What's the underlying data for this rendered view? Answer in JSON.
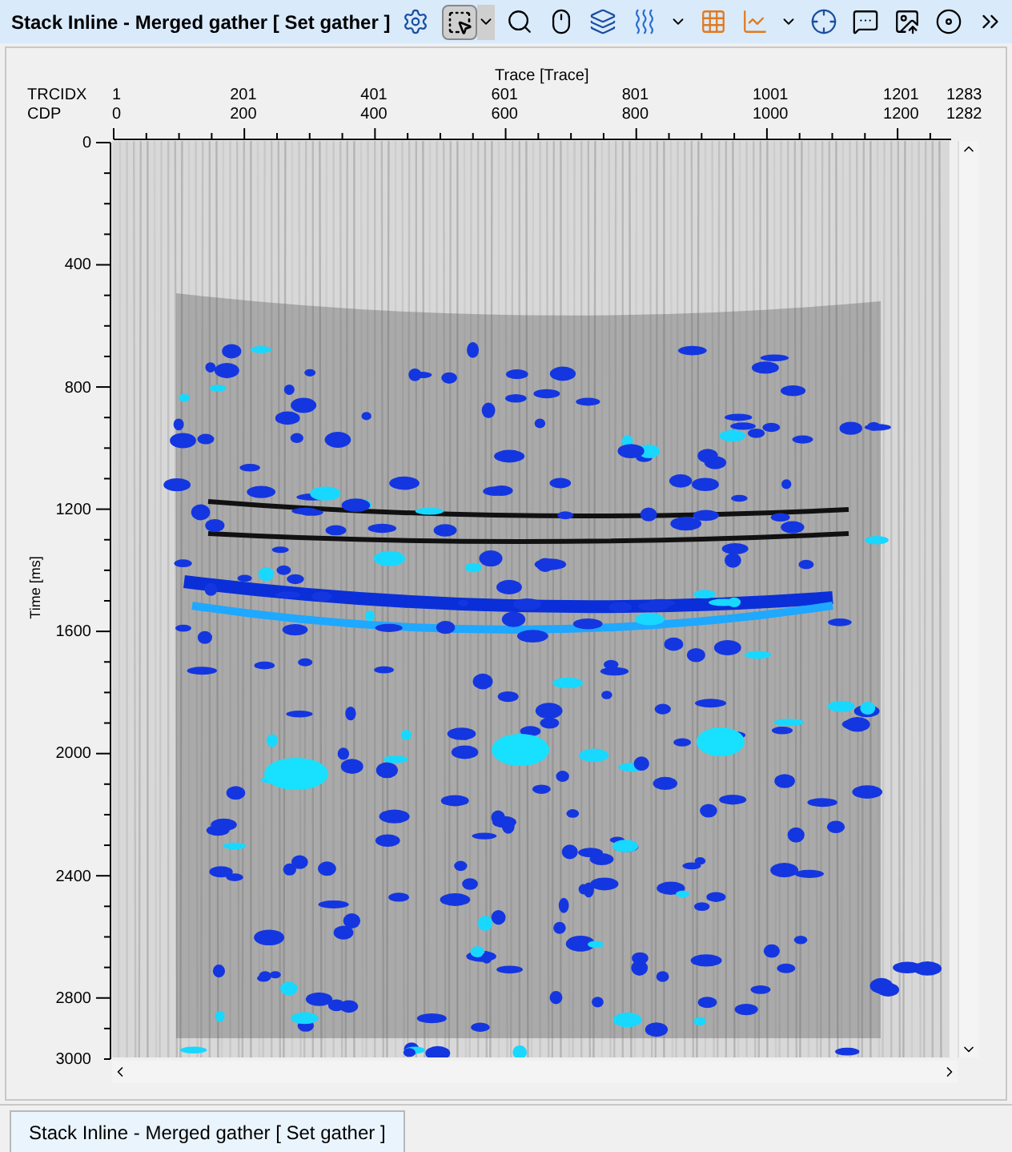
{
  "window": {
    "title": "Stack Inline - Merged gather [ Set gather ]"
  },
  "toolbar": {
    "select_tool_active": true
  },
  "x_axis": {
    "title": "Trace [Trace]",
    "rows": [
      {
        "label": "TRCIDX",
        "ticks": [
          "1",
          "201",
          "401",
          "601",
          "801",
          "1001",
          "1201",
          "1283"
        ]
      },
      {
        "label": "CDP",
        "ticks": [
          "0",
          "200",
          "400",
          "600",
          "800",
          "1000",
          "1200",
          "1282"
        ]
      }
    ]
  },
  "y_axis": {
    "title": "Time [ms]",
    "ticks": [
      "0",
      "400",
      "800",
      "1200",
      "1600",
      "2000",
      "2400",
      "2800",
      "3000"
    ]
  },
  "tabs": [
    {
      "label": "Stack Inline - Merged gather [ Set gather ]",
      "selected": true
    }
  ]
}
